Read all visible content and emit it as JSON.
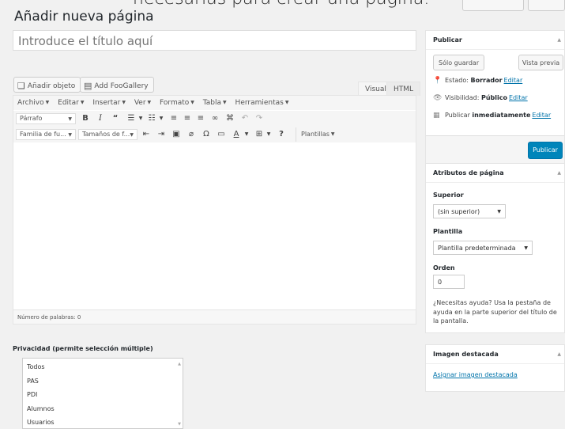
{
  "caption": "necesarias para crear una página.",
  "page": {
    "heading": "Añadir nueva página",
    "title_placeholder": "Introduce el título aquí"
  },
  "media": {
    "add_object": "Añadir objeto",
    "add_foogallery": "Add FooGallery"
  },
  "editor_tabs": {
    "visual": "Visual",
    "html": "HTML"
  },
  "menubar": [
    "Archivo",
    "Editar",
    "Insertar",
    "Ver",
    "Formato",
    "Tabla",
    "Herramientas"
  ],
  "toolbar": {
    "format_select": "Párrafo",
    "font_family": "Familia de fu...",
    "font_size": "Tamaños de f...",
    "templates": "Plantillas"
  },
  "word_count": "Número de palabras: 0",
  "privacy": {
    "label": "Privacidad (permite selección múltiple)",
    "options": [
      "Todos",
      "PAS",
      "PDI",
      "Alumnos",
      "Usuarios"
    ]
  },
  "publish_box": {
    "title": "Publicar",
    "save_draft": "Sólo guardar",
    "preview": "Vista previa",
    "status_label": "Estado:",
    "status_value": "Borrador",
    "visibility_label": "Visibilidad:",
    "visibility_value": "Público",
    "publish_label": "Publicar",
    "publish_value": "inmediatamente",
    "edit_link": "Editar",
    "publish_button": "Publicar"
  },
  "attributes_box": {
    "title": "Atributos de página",
    "parent_label": "Superior",
    "parent_value": "(sin superior)",
    "template_label": "Plantilla",
    "template_value": "Plantilla predeterminada",
    "order_label": "Orden",
    "order_value": "0",
    "help": "¿Necesitas ayuda? Usa la pestaña de ayuda en la parte superior del título de la pantalla."
  },
  "featured_box": {
    "title": "Imagen destacada",
    "assign_link": "Asignar imagen destacada"
  },
  "colors": {
    "accent": "#0085ba",
    "link": "#0073aa",
    "background": "#f1f1f1"
  },
  "icons": [
    "media-icon",
    "gallery-icon",
    "pin-icon",
    "eye-icon",
    "calendar-icon",
    "help-icon"
  ]
}
